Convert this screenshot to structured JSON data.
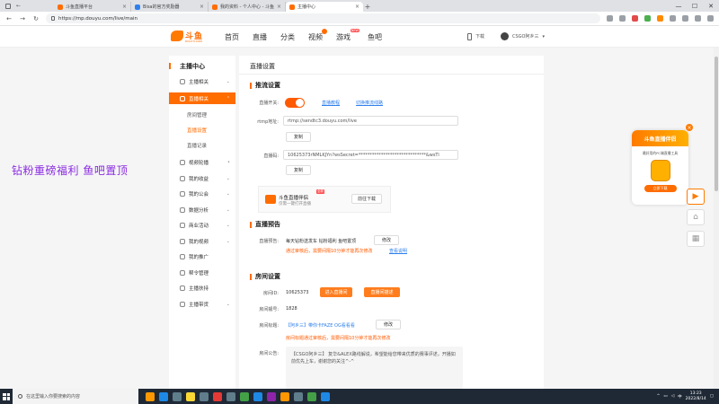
{
  "browser": {
    "tabs": [
      {
        "label": "斗鱼直播平台"
      },
      {
        "label": "Bisa的官方奖励器"
      },
      {
        "label": "我的资料 - 个人中心 - 斗鱼"
      },
      {
        "label": "主播中心"
      }
    ],
    "new_tab": "+",
    "url": "https://mp.douyu.com/live/main",
    "minimize": "—",
    "maximize": "☐",
    "close": "✕"
  },
  "site": {
    "brand": "斗鱼",
    "brand_sub": "DOUYU.COM",
    "nav": [
      "首页",
      "直播",
      "分类",
      "视频",
      "游戏",
      "鱼吧"
    ],
    "nav_new_badge": "NEW",
    "download": "下载",
    "username": "CSGO阿乡三"
  },
  "sidebar": {
    "title": "主播中心",
    "items": [
      {
        "label": "主播相关"
      },
      {
        "label": "直播相关"
      },
      {
        "label": "视频轮播"
      },
      {
        "label": "我的收益"
      },
      {
        "label": "我的公会"
      },
      {
        "label": "数据分析"
      },
      {
        "label": "商业活动"
      },
      {
        "label": "我的视频"
      },
      {
        "label": "我的推广"
      },
      {
        "label": "帮令管理"
      },
      {
        "label": "主播扶持"
      },
      {
        "label": "主播带货"
      }
    ],
    "subitems": [
      "房间管理",
      "直播设置",
      "直播记录"
    ]
  },
  "content": {
    "title": "直播设置",
    "stream": {
      "section": "推流设置",
      "switch_label": "直播开关:",
      "link_tutorial": "直播教程",
      "link_record": "切换推流线路",
      "rtmp_label": "rtmp地址:",
      "rtmp_value": "rtmp://sendtc3.douyu.com/live",
      "copy": "复制",
      "code_label": "直播码:",
      "code_value": "10625373rNMLKJYn?wsSecret=******************************&wsTi",
      "helper_name": "斗鱼直播伴侣",
      "helper_badge": "全新",
      "helper_desc": "仅需一键打开直播",
      "helper_download": "前往下载"
    },
    "preview": {
      "section": "直播预告",
      "label": "直播预告:",
      "value": "每天钻粉送发车 钻粉福利 鱼吧置顶",
      "edit": "修改",
      "status": "通过审核后，需要间隔10分钟才能再次修改",
      "view_reason": "查看说明"
    },
    "room": {
      "section": "房间设置",
      "id_label": "房间ID:",
      "id_value": "10625373",
      "enter_room": "进入直播间",
      "room_desc": "直播间描述",
      "no_label": "房间靓号:",
      "no_value": "1828",
      "title_label": "房间标题:",
      "title_value": "【阿乡三】带你卡FAZE OG看看看",
      "title_edit": "修改",
      "title_status": "房间标题通过审核后，需要间隔10分钟才能再次修改",
      "notice_label": "房间公告:",
      "notice_value": "【CSGO阿乡三】 复华&ALEX路线解说，希望能给您带来优质的赛事评述，开播如前优先上车，谢谢您的关注^-^"
    }
  },
  "promo_text": "钻粉重磅福利 鱼吧置顶",
  "float_widget": {
    "title": "斗鱼直播伴侣",
    "desc": "最好用的PC端直播工具",
    "button": "立即下载"
  },
  "taskbar": {
    "search_placeholder": "在这里输入你要搜索的内容",
    "time": "13:23",
    "date": "2022/8/14"
  }
}
